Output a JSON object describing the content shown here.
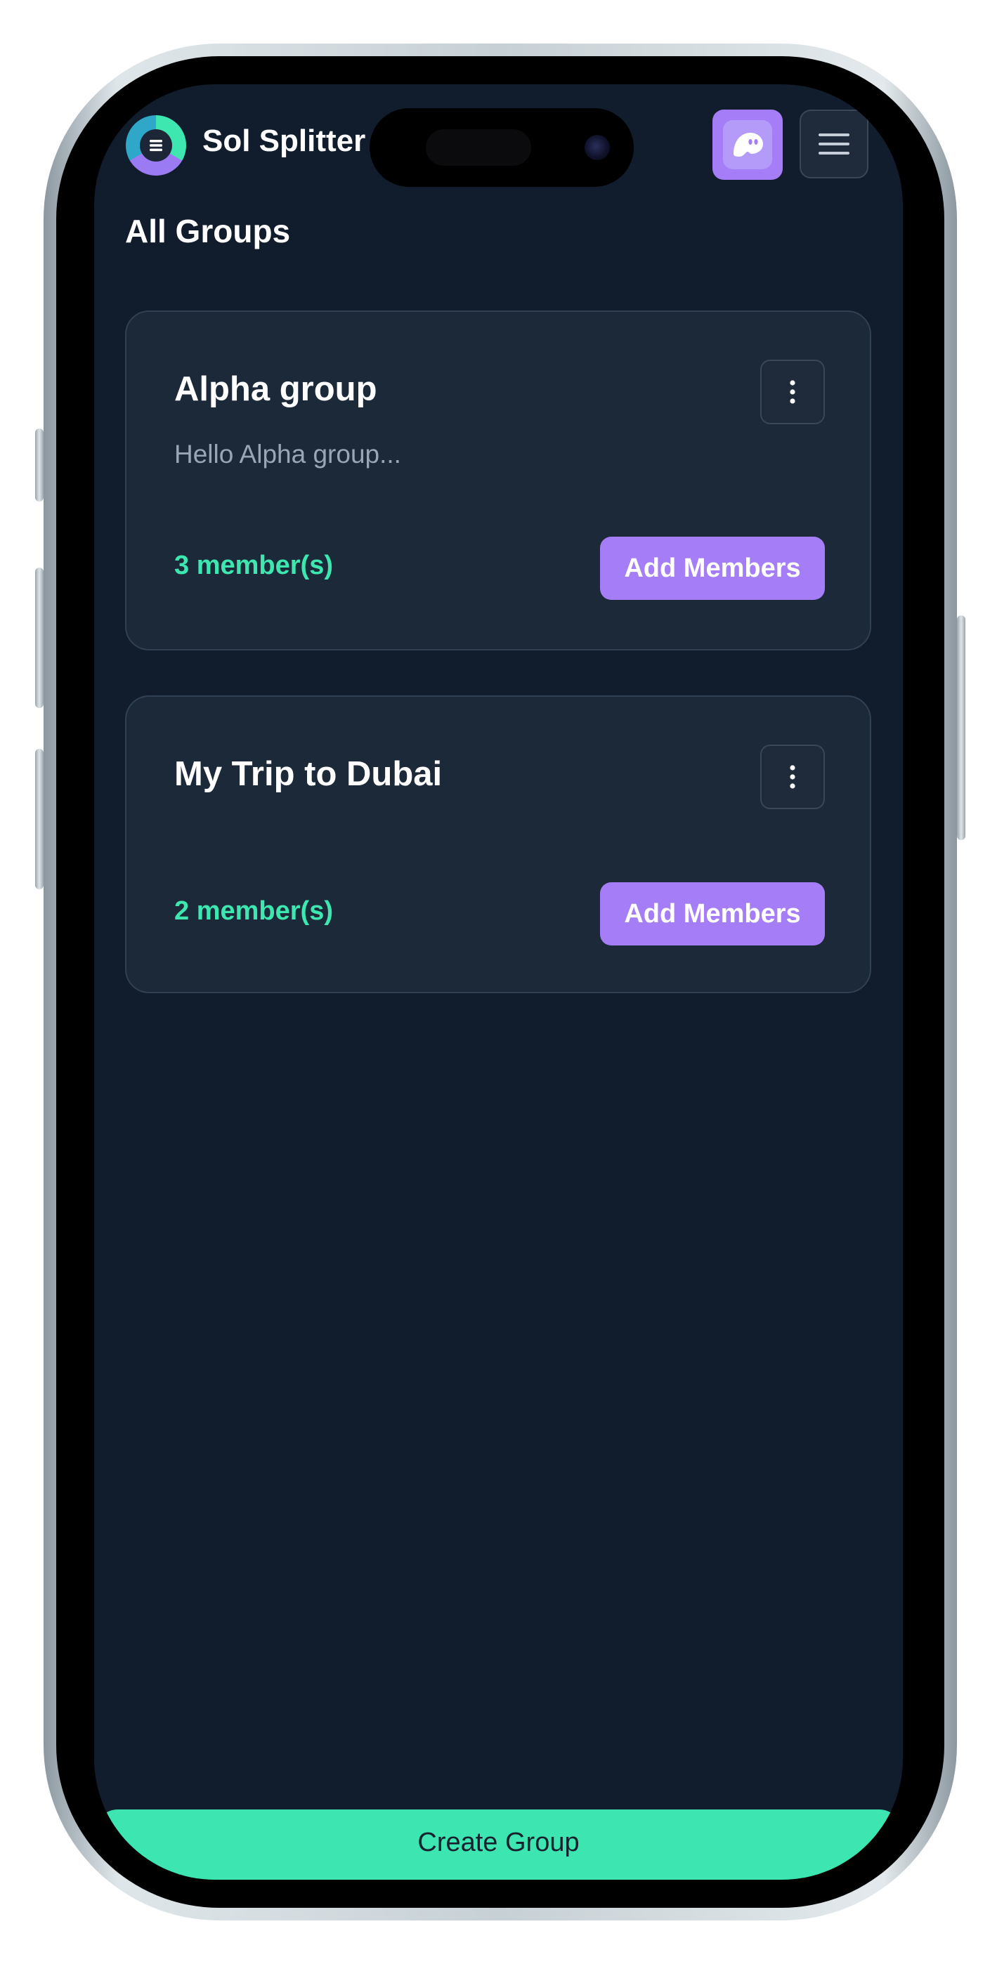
{
  "header": {
    "app_title": "Sol Splitter",
    "logo_icon": "sol-splitter-logo-icon",
    "wallet_icon": "phantom-ghost-icon",
    "menu_icon": "hamburger-menu-icon"
  },
  "page": {
    "title": "All Groups"
  },
  "groups": [
    {
      "name": "Alpha group",
      "description": "Hello Alpha group...",
      "members": "3 member(s)",
      "add_label": "Add Members",
      "options_icon": "kebab-menu-icon"
    },
    {
      "name": "My Trip to Dubai",
      "description": "",
      "members": "2 member(s)",
      "add_label": "Add Members",
      "options_icon": "kebab-menu-icon"
    }
  ],
  "actions": {
    "create_label": "Create Group"
  },
  "colors": {
    "background": "#111c2c",
    "card": "#1c2939",
    "accent_purple": "#a57ef7",
    "accent_green": "#3ee6b0"
  }
}
